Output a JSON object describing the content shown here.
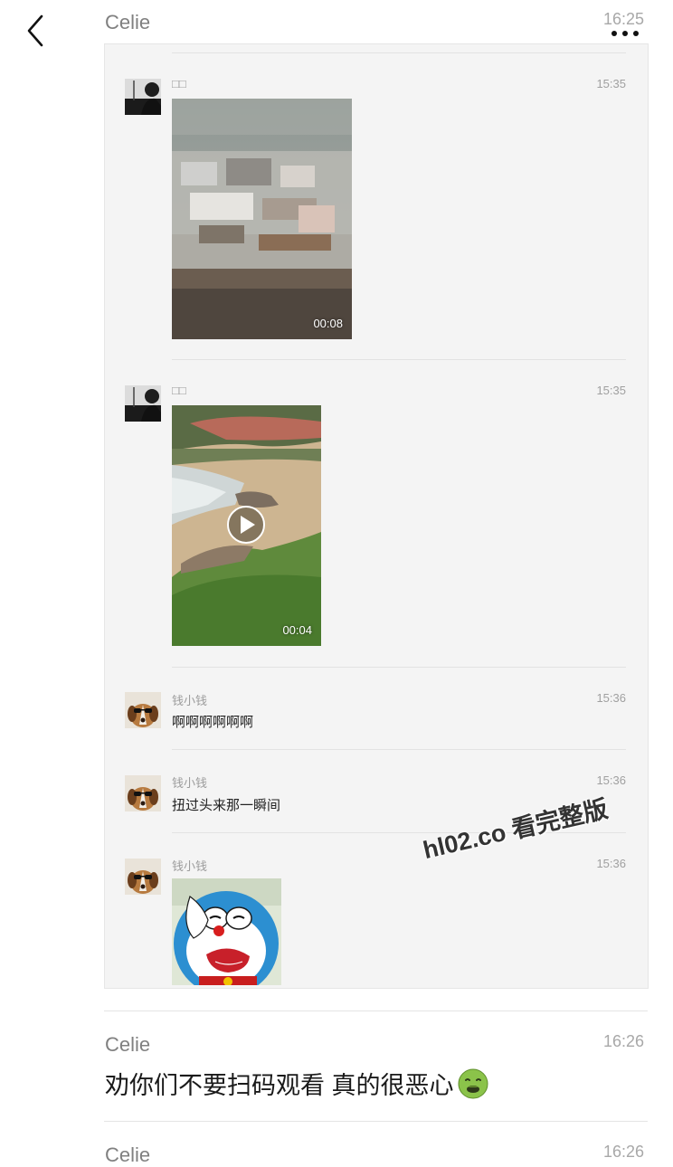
{
  "header": {
    "sender": "Celie",
    "time": "16:25"
  },
  "record": {
    "messages": [
      {
        "name": "□□",
        "time": "15:35",
        "video_duration": "00:08"
      },
      {
        "name": "□□",
        "time": "15:35",
        "video_duration": "00:04"
      },
      {
        "name": "钱小钱",
        "time": "15:36",
        "text": "啊啊啊啊啊啊"
      },
      {
        "name": "钱小钱",
        "time": "15:36",
        "text": "扭过头来那一瞬间"
      },
      {
        "name": "钱小钱",
        "time": "15:36"
      }
    ]
  },
  "watermark": "hl02.co 看完整版",
  "bottom": [
    {
      "sender": "Celie",
      "time": "16:26",
      "text": "劝你们不要扫码观看 真的很恶心"
    },
    {
      "sender": "Celie",
      "time": "16:26"
    }
  ],
  "icons": {
    "back": "chevron-left-icon",
    "more": "more-dots-icon",
    "play": "play-icon",
    "emoji": "nauseated-face-emoji"
  },
  "colors": {
    "record_bg": "#f4f4f4",
    "meta_text": "#9b9b9b"
  }
}
